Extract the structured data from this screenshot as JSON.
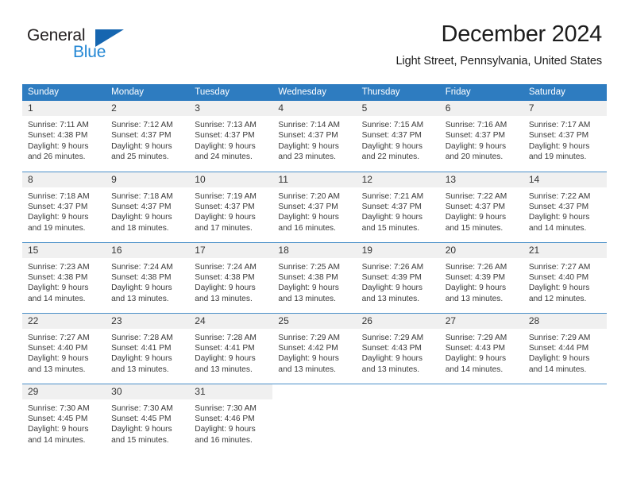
{
  "logo": {
    "word1": "General",
    "word2": "Blue",
    "triangle_color": "#1666b0",
    "blue_color": "#2387d4"
  },
  "header": {
    "title": "December 2024",
    "location": "Light Street, Pennsylvania, United States"
  },
  "theme": {
    "header_bg": "#2e7cc0",
    "daynum_bg": "#f0f0f0",
    "row_border": "#4a8fc8"
  },
  "weekday_headers": [
    "Sunday",
    "Monday",
    "Tuesday",
    "Wednesday",
    "Thursday",
    "Friday",
    "Saturday"
  ],
  "weeks": [
    [
      {
        "day": "1",
        "sunrise": "Sunrise: 7:11 AM",
        "sunset": "Sunset: 4:38 PM",
        "daylight1": "Daylight: 9 hours",
        "daylight2": "and 26 minutes."
      },
      {
        "day": "2",
        "sunrise": "Sunrise: 7:12 AM",
        "sunset": "Sunset: 4:37 PM",
        "daylight1": "Daylight: 9 hours",
        "daylight2": "and 25 minutes."
      },
      {
        "day": "3",
        "sunrise": "Sunrise: 7:13 AM",
        "sunset": "Sunset: 4:37 PM",
        "daylight1": "Daylight: 9 hours",
        "daylight2": "and 24 minutes."
      },
      {
        "day": "4",
        "sunrise": "Sunrise: 7:14 AM",
        "sunset": "Sunset: 4:37 PM",
        "daylight1": "Daylight: 9 hours",
        "daylight2": "and 23 minutes."
      },
      {
        "day": "5",
        "sunrise": "Sunrise: 7:15 AM",
        "sunset": "Sunset: 4:37 PM",
        "daylight1": "Daylight: 9 hours",
        "daylight2": "and 22 minutes."
      },
      {
        "day": "6",
        "sunrise": "Sunrise: 7:16 AM",
        "sunset": "Sunset: 4:37 PM",
        "daylight1": "Daylight: 9 hours",
        "daylight2": "and 20 minutes."
      },
      {
        "day": "7",
        "sunrise": "Sunrise: 7:17 AM",
        "sunset": "Sunset: 4:37 PM",
        "daylight1": "Daylight: 9 hours",
        "daylight2": "and 19 minutes."
      }
    ],
    [
      {
        "day": "8",
        "sunrise": "Sunrise: 7:18 AM",
        "sunset": "Sunset: 4:37 PM",
        "daylight1": "Daylight: 9 hours",
        "daylight2": "and 19 minutes."
      },
      {
        "day": "9",
        "sunrise": "Sunrise: 7:18 AM",
        "sunset": "Sunset: 4:37 PM",
        "daylight1": "Daylight: 9 hours",
        "daylight2": "and 18 minutes."
      },
      {
        "day": "10",
        "sunrise": "Sunrise: 7:19 AM",
        "sunset": "Sunset: 4:37 PM",
        "daylight1": "Daylight: 9 hours",
        "daylight2": "and 17 minutes."
      },
      {
        "day": "11",
        "sunrise": "Sunrise: 7:20 AM",
        "sunset": "Sunset: 4:37 PM",
        "daylight1": "Daylight: 9 hours",
        "daylight2": "and 16 minutes."
      },
      {
        "day": "12",
        "sunrise": "Sunrise: 7:21 AM",
        "sunset": "Sunset: 4:37 PM",
        "daylight1": "Daylight: 9 hours",
        "daylight2": "and 15 minutes."
      },
      {
        "day": "13",
        "sunrise": "Sunrise: 7:22 AM",
        "sunset": "Sunset: 4:37 PM",
        "daylight1": "Daylight: 9 hours",
        "daylight2": "and 15 minutes."
      },
      {
        "day": "14",
        "sunrise": "Sunrise: 7:22 AM",
        "sunset": "Sunset: 4:37 PM",
        "daylight1": "Daylight: 9 hours",
        "daylight2": "and 14 minutes."
      }
    ],
    [
      {
        "day": "15",
        "sunrise": "Sunrise: 7:23 AM",
        "sunset": "Sunset: 4:38 PM",
        "daylight1": "Daylight: 9 hours",
        "daylight2": "and 14 minutes."
      },
      {
        "day": "16",
        "sunrise": "Sunrise: 7:24 AM",
        "sunset": "Sunset: 4:38 PM",
        "daylight1": "Daylight: 9 hours",
        "daylight2": "and 13 minutes."
      },
      {
        "day": "17",
        "sunrise": "Sunrise: 7:24 AM",
        "sunset": "Sunset: 4:38 PM",
        "daylight1": "Daylight: 9 hours",
        "daylight2": "and 13 minutes."
      },
      {
        "day": "18",
        "sunrise": "Sunrise: 7:25 AM",
        "sunset": "Sunset: 4:38 PM",
        "daylight1": "Daylight: 9 hours",
        "daylight2": "and 13 minutes."
      },
      {
        "day": "19",
        "sunrise": "Sunrise: 7:26 AM",
        "sunset": "Sunset: 4:39 PM",
        "daylight1": "Daylight: 9 hours",
        "daylight2": "and 13 minutes."
      },
      {
        "day": "20",
        "sunrise": "Sunrise: 7:26 AM",
        "sunset": "Sunset: 4:39 PM",
        "daylight1": "Daylight: 9 hours",
        "daylight2": "and 13 minutes."
      },
      {
        "day": "21",
        "sunrise": "Sunrise: 7:27 AM",
        "sunset": "Sunset: 4:40 PM",
        "daylight1": "Daylight: 9 hours",
        "daylight2": "and 12 minutes."
      }
    ],
    [
      {
        "day": "22",
        "sunrise": "Sunrise: 7:27 AM",
        "sunset": "Sunset: 4:40 PM",
        "daylight1": "Daylight: 9 hours",
        "daylight2": "and 13 minutes."
      },
      {
        "day": "23",
        "sunrise": "Sunrise: 7:28 AM",
        "sunset": "Sunset: 4:41 PM",
        "daylight1": "Daylight: 9 hours",
        "daylight2": "and 13 minutes."
      },
      {
        "day": "24",
        "sunrise": "Sunrise: 7:28 AM",
        "sunset": "Sunset: 4:41 PM",
        "daylight1": "Daylight: 9 hours",
        "daylight2": "and 13 minutes."
      },
      {
        "day": "25",
        "sunrise": "Sunrise: 7:29 AM",
        "sunset": "Sunset: 4:42 PM",
        "daylight1": "Daylight: 9 hours",
        "daylight2": "and 13 minutes."
      },
      {
        "day": "26",
        "sunrise": "Sunrise: 7:29 AM",
        "sunset": "Sunset: 4:43 PM",
        "daylight1": "Daylight: 9 hours",
        "daylight2": "and 13 minutes."
      },
      {
        "day": "27",
        "sunrise": "Sunrise: 7:29 AM",
        "sunset": "Sunset: 4:43 PM",
        "daylight1": "Daylight: 9 hours",
        "daylight2": "and 14 minutes."
      },
      {
        "day": "28",
        "sunrise": "Sunrise: 7:29 AM",
        "sunset": "Sunset: 4:44 PM",
        "daylight1": "Daylight: 9 hours",
        "daylight2": "and 14 minutes."
      }
    ],
    [
      {
        "day": "29",
        "sunrise": "Sunrise: 7:30 AM",
        "sunset": "Sunset: 4:45 PM",
        "daylight1": "Daylight: 9 hours",
        "daylight2": "and 14 minutes."
      },
      {
        "day": "30",
        "sunrise": "Sunrise: 7:30 AM",
        "sunset": "Sunset: 4:45 PM",
        "daylight1": "Daylight: 9 hours",
        "daylight2": "and 15 minutes."
      },
      {
        "day": "31",
        "sunrise": "Sunrise: 7:30 AM",
        "sunset": "Sunset: 4:46 PM",
        "daylight1": "Daylight: 9 hours",
        "daylight2": "and 16 minutes."
      },
      {
        "day": "",
        "sunrise": "",
        "sunset": "",
        "daylight1": "",
        "daylight2": ""
      },
      {
        "day": "",
        "sunrise": "",
        "sunset": "",
        "daylight1": "",
        "daylight2": ""
      },
      {
        "day": "",
        "sunrise": "",
        "sunset": "",
        "daylight1": "",
        "daylight2": ""
      },
      {
        "day": "",
        "sunrise": "",
        "sunset": "",
        "daylight1": "",
        "daylight2": ""
      }
    ]
  ]
}
